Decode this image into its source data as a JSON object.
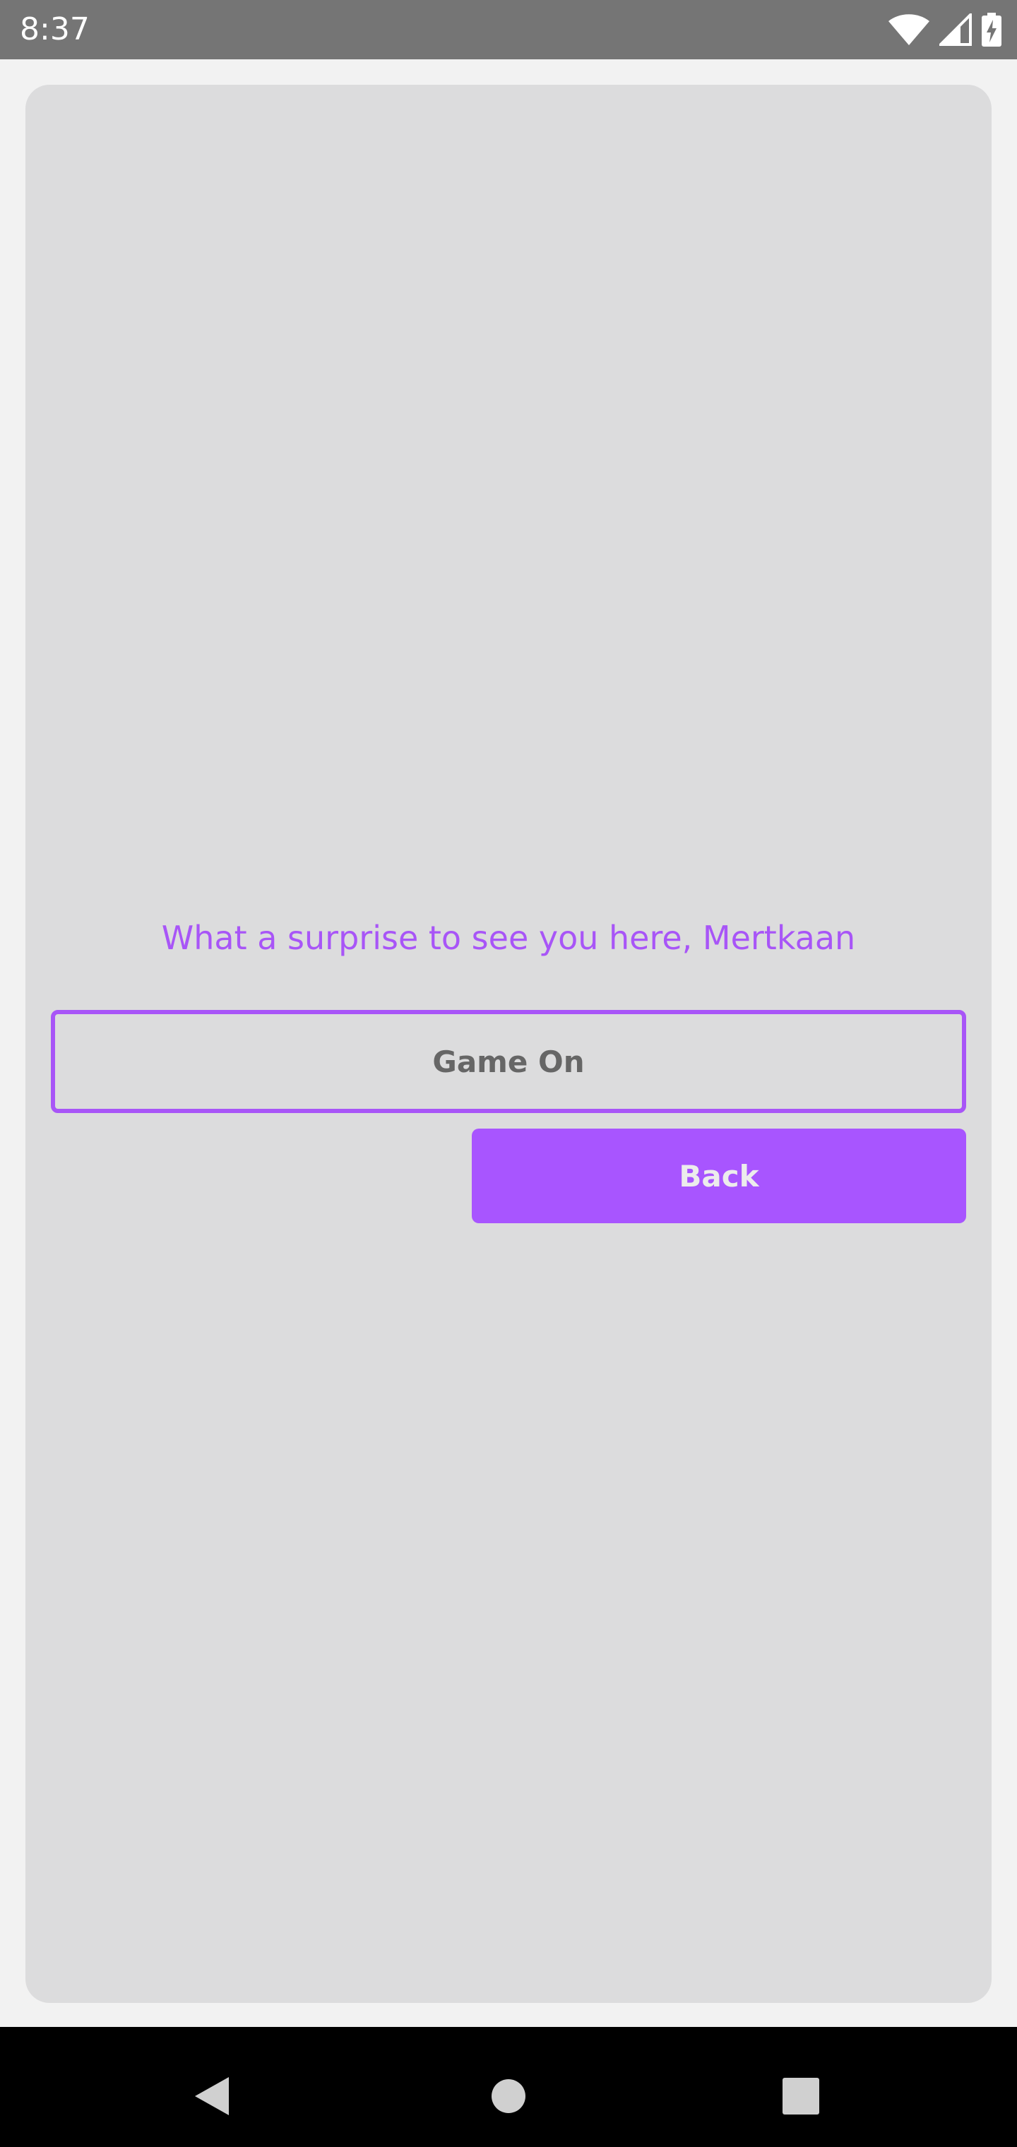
{
  "status_bar": {
    "time": "8:37",
    "icons": [
      "wifi-icon",
      "signal-icon",
      "battery-charging-icon"
    ]
  },
  "main": {
    "greeting": "What a surprise to see you here, Mertkaan",
    "game_on_label": "Game On",
    "back_label": "Back"
  },
  "nav_bar": {
    "icons": [
      "back-triangle-icon",
      "home-circle-icon",
      "recents-square-icon"
    ]
  },
  "colors": {
    "accent": "#a855f7",
    "card_background": "#dcdcdd",
    "status_bar": "#757575",
    "nav_bar": "#000000"
  }
}
